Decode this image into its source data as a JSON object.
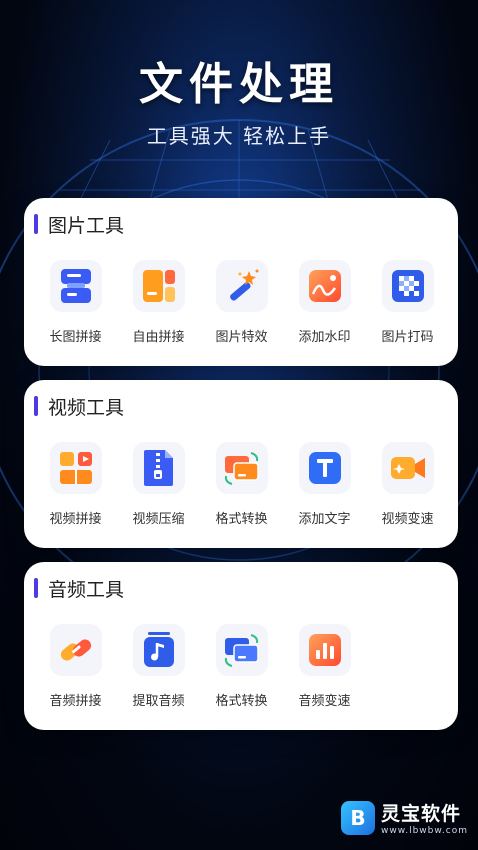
{
  "header": {
    "title": "文件处理",
    "subtitle": "工具强大 轻松上手"
  },
  "sections": [
    {
      "title": "图片工具",
      "tools": [
        {
          "label": "长图拼接",
          "icon": "long-image-stitch-icon"
        },
        {
          "label": "自由拼接",
          "icon": "free-collage-icon"
        },
        {
          "label": "图片特效",
          "icon": "magic-wand-icon"
        },
        {
          "label": "添加水印",
          "icon": "watermark-image-icon"
        },
        {
          "label": "图片打码",
          "icon": "mosaic-icon"
        }
      ]
    },
    {
      "title": "视频工具",
      "tools": [
        {
          "label": "视频拼接",
          "icon": "video-stitch-icon"
        },
        {
          "label": "视频压缩",
          "icon": "zip-file-icon"
        },
        {
          "label": "格式转换",
          "icon": "format-convert-icon"
        },
        {
          "label": "添加文字",
          "icon": "text-t-icon"
        },
        {
          "label": "视频变速",
          "icon": "video-camera-icon"
        }
      ]
    },
    {
      "title": "音频工具",
      "tools": [
        {
          "label": "音频拼接",
          "icon": "audio-link-icon"
        },
        {
          "label": "提取音频",
          "icon": "music-note-icon"
        },
        {
          "label": "格式转换",
          "icon": "format-convert-icon"
        },
        {
          "label": "音频变速",
          "icon": "bar-chart-icon"
        }
      ]
    }
  ],
  "watermark": {
    "name": "灵宝软件",
    "url": "www.lbwbw.com"
  },
  "colors": {
    "accent": "#4b3be0",
    "orange": "#ff7a2e",
    "blue": "#2f6df6"
  }
}
